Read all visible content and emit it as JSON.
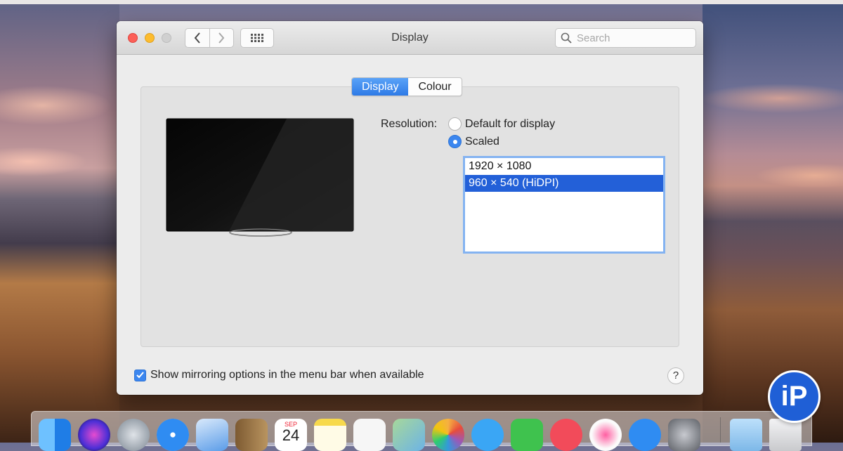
{
  "window": {
    "title": "Display",
    "search_placeholder": "Search"
  },
  "tabs": [
    {
      "label": "Display",
      "active": true
    },
    {
      "label": "Colour",
      "active": false
    }
  ],
  "resolution": {
    "label": "Resolution:",
    "options": [
      {
        "label": "Default for display",
        "selected": false
      },
      {
        "label": "Scaled",
        "selected": true
      }
    ],
    "list": [
      {
        "label": "1920 × 1080",
        "selected": false
      },
      {
        "label": "960 × 540 (HiDPI)",
        "selected": true
      }
    ]
  },
  "mirroring": {
    "label": "Show mirroring options in the menu bar when available",
    "checked": true
  },
  "help_label": "?",
  "dock": {
    "items": [
      {
        "icon": "finder-icon",
        "color": "#2f8cf2"
      },
      {
        "icon": "siri-icon",
        "color": "#7b3ad6"
      },
      {
        "icon": "launchpad-icon",
        "color": "#9aa3ad"
      },
      {
        "icon": "safari-icon",
        "color": "#2f8cf2"
      },
      {
        "icon": "mail-icon",
        "color": "#5a9ce8"
      },
      {
        "icon": "contacts-icon",
        "color": "#a27a4a"
      },
      {
        "icon": "calendar-icon",
        "color": "#ffffff",
        "month": "SEP",
        "day": "24"
      },
      {
        "icon": "notes-icon",
        "color": "#f7d94c"
      },
      {
        "icon": "reminders-icon",
        "color": "#f2f2f2"
      },
      {
        "icon": "maps-icon",
        "color": "#7ebf6b"
      },
      {
        "icon": "photos-icon",
        "color": "#f4f4f4"
      },
      {
        "icon": "messages-icon",
        "color": "#3aa6f5"
      },
      {
        "icon": "facetime-icon",
        "color": "#3fc24e"
      },
      {
        "icon": "news-icon",
        "color": "#f24b5a"
      },
      {
        "icon": "itunes-icon",
        "color": "#f3f3f3"
      },
      {
        "icon": "app-store-icon",
        "color": "#2f8cf2"
      },
      {
        "icon": "system-preferences-icon",
        "color": "#8e9096"
      },
      {
        "icon": "downloads-folder-icon",
        "color": "#8fc4ee"
      },
      {
        "icon": "trash-icon",
        "color": "#e8e8ea"
      }
    ]
  },
  "logo": {
    "text": "iP",
    "color": "#1f5fd6"
  }
}
